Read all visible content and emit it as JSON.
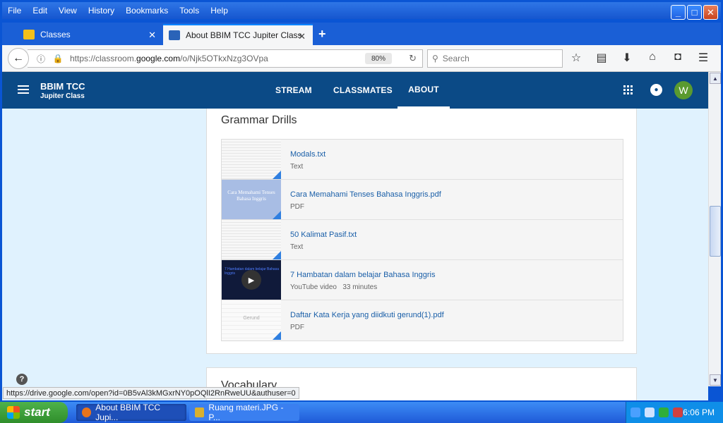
{
  "menubar": {
    "items": [
      "File",
      "Edit",
      "View",
      "History",
      "Bookmarks",
      "Tools",
      "Help"
    ]
  },
  "window_controls": {
    "minimize": "_",
    "maximize": "□",
    "close": "✕"
  },
  "tabs": [
    {
      "label": "Classes",
      "close": "✕"
    },
    {
      "label": "About BBIM TCC Jupiter Class",
      "close": "✕"
    }
  ],
  "new_tab": "+",
  "navbar": {
    "url_prefix": "https://classroom.",
    "url_domain": "google.com",
    "url_path": "/o/Njk5OTkxNzg3OVpa",
    "zoom": "80%",
    "search_placeholder": "Search"
  },
  "classroom": {
    "class_name": "BBIM TCC",
    "class_section": "Jupiter Class",
    "nav": [
      "STREAM",
      "CLASSMATES",
      "ABOUT"
    ],
    "avatar_letter": "W"
  },
  "grammar": {
    "title": "Grammar Drills",
    "items": [
      {
        "name": "Modals.txt",
        "type": "Text"
      },
      {
        "name": "Cara Memahami Tenses Bahasa Inggris.pdf",
        "type": "PDF",
        "thumb_text": "Cara Memahami Tenses Bahasa Inggris"
      },
      {
        "name": "50 Kalimat Pasif.txt",
        "type": "Text"
      },
      {
        "name": "7 Hambatan dalam belajar Bahasa Inggris",
        "type": "YouTube video   33 minutes",
        "thumb_text": "7 Hambatan dalam belajar Bahasa Inggris"
      },
      {
        "name": "Daftar Kata Kerja yang diidkuti gerund(1).pdf",
        "type": "PDF",
        "thumb_text": "Gerund"
      }
    ]
  },
  "vocabulary": {
    "title": "Vocabulary"
  },
  "help": "?",
  "status_link": "https://drive.google.com/open?id=0B5vAl3kMGxrNY0pOQlI2RnRweUU&authuser=0",
  "taskbar": {
    "start": "start",
    "tasks": [
      "About BBIM TCC Jupi...",
      "Ruang materi.JPG - P..."
    ],
    "clock": "6:06 PM"
  }
}
